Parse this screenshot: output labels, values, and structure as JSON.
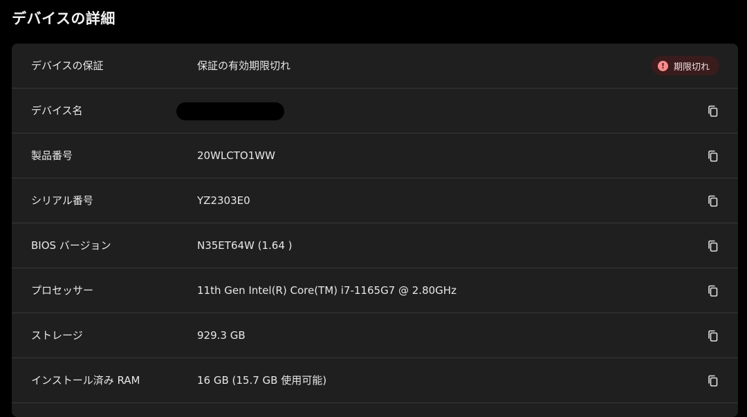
{
  "page": {
    "title": "デバイスの詳細"
  },
  "rows": [
    {
      "label": "デバイスの保証",
      "value": "保証の有効期限切れ",
      "badge": "期限切れ"
    },
    {
      "label": "デバイス名",
      "value": ""
    },
    {
      "label": "製品番号",
      "value": "20WLCTO1WW"
    },
    {
      "label": "シリアル番号",
      "value": "YZ2303E0"
    },
    {
      "label": "BIOS バージョン",
      "value": "N35ET64W (1.64 )"
    },
    {
      "label": "プロセッサー",
      "value": "11th Gen Intel(R) Core(TM) i7-1165G7 @ 2.80GHz"
    },
    {
      "label": "ストレージ",
      "value": "929.3 GB"
    },
    {
      "label": "インストール済み RAM",
      "value": "16 GB (15.7 GB 使用可能)"
    }
  ],
  "icons": {
    "copy": "copy-icon",
    "alert": "alert-icon"
  },
  "colors": {
    "background": "#000000",
    "panel": "#1f1f1f",
    "divider": "#383838",
    "badge_bg": "#3a1c1c",
    "badge_icon": "#ff8a8a"
  }
}
